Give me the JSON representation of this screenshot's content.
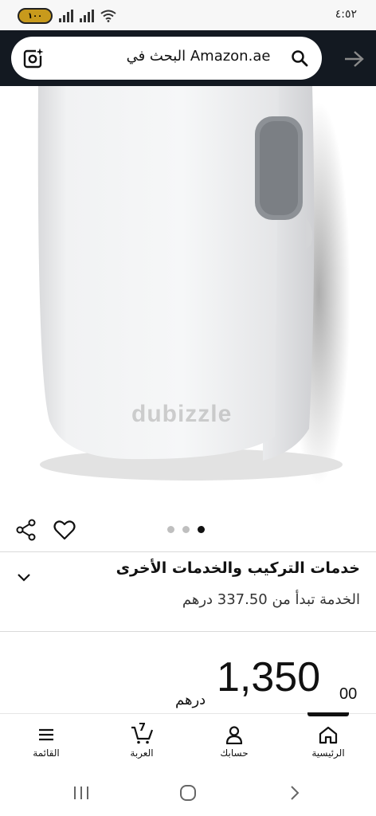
{
  "status_bar": {
    "time": "٤:٥٢",
    "battery": "١٠٠"
  },
  "search": {
    "placeholder": "البحث في Amazon.ae"
  },
  "watermark": "dubizzle",
  "services": {
    "title": "خدمات التركيب والخدمات الأخرى",
    "subtitle": "الخدمة تبدأ من 337.50 درهم"
  },
  "price": {
    "currency": "درهم",
    "whole": "1,350",
    "fraction": "00"
  },
  "bottom_nav": {
    "items": [
      {
        "label": "الرئيسية",
        "icon": "home-icon"
      },
      {
        "label": "حسابك",
        "icon": "account-icon"
      },
      {
        "label": "العربة",
        "icon": "cart-icon",
        "badge": "7"
      },
      {
        "label": "القائمة",
        "icon": "menu-icon"
      }
    ]
  },
  "image_carousel": {
    "total": 3,
    "active_index": 2
  },
  "colors": {
    "header_bg": "#131921",
    "status_bg": "#f7f7f7",
    "accent": "#111111"
  }
}
